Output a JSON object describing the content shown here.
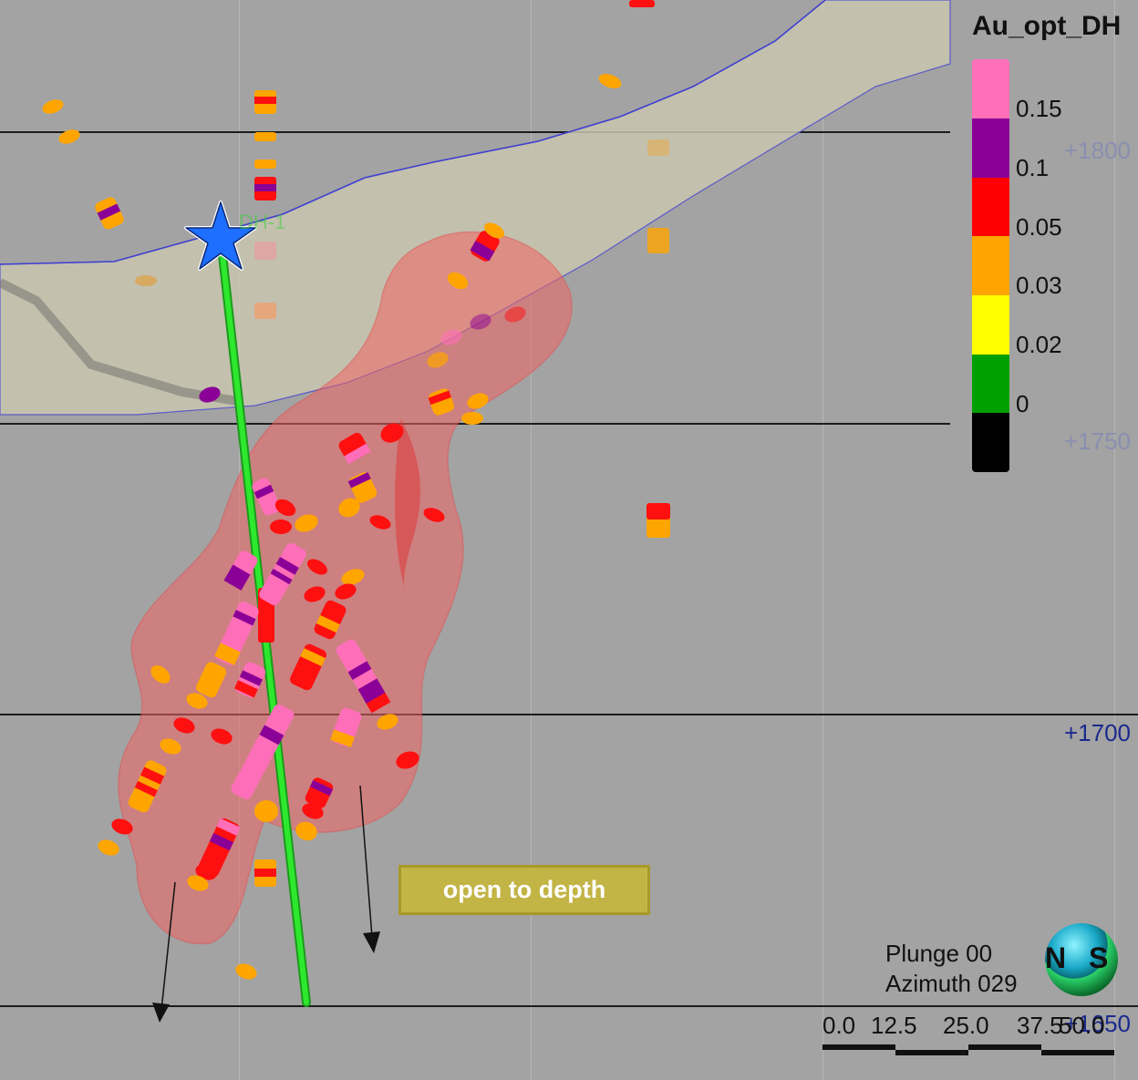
{
  "legend": {
    "title": "Au_opt_DH",
    "bins": [
      {
        "label": "0.15",
        "color": "#ff6eb8"
      },
      {
        "label": "0.1",
        "color": "#8b0096"
      },
      {
        "label": "0.05",
        "color": "#ff0000"
      },
      {
        "label": "0.03",
        "color": "#ffa500"
      },
      {
        "label": "0.02",
        "color": "#ffff00"
      },
      {
        "label": "0",
        "color": "#00a000"
      },
      {
        "label": "",
        "color": "#000000"
      }
    ]
  },
  "elevations": {
    "e1800": "+1800",
    "e1750": "+1750",
    "e1700": "+1700",
    "e1650": "+1650"
  },
  "drillhole_label": "DH-1",
  "callout": "open to depth",
  "view": {
    "plunge": "Plunge 00",
    "azimuth": "Azimuth 029"
  },
  "scale_bar": {
    "labels": [
      "0.0",
      "12.5",
      "25.0",
      "37.5",
      "50.0"
    ]
  },
  "compass": {
    "left": "N",
    "right": "S"
  },
  "colors": {
    "background": "#a3a3a3",
    "ore_shell": "#f06565",
    "drill_trace": "#22dd22",
    "collar_star": "#1e6fff",
    "surface_band": "#c9c6b0"
  }
}
